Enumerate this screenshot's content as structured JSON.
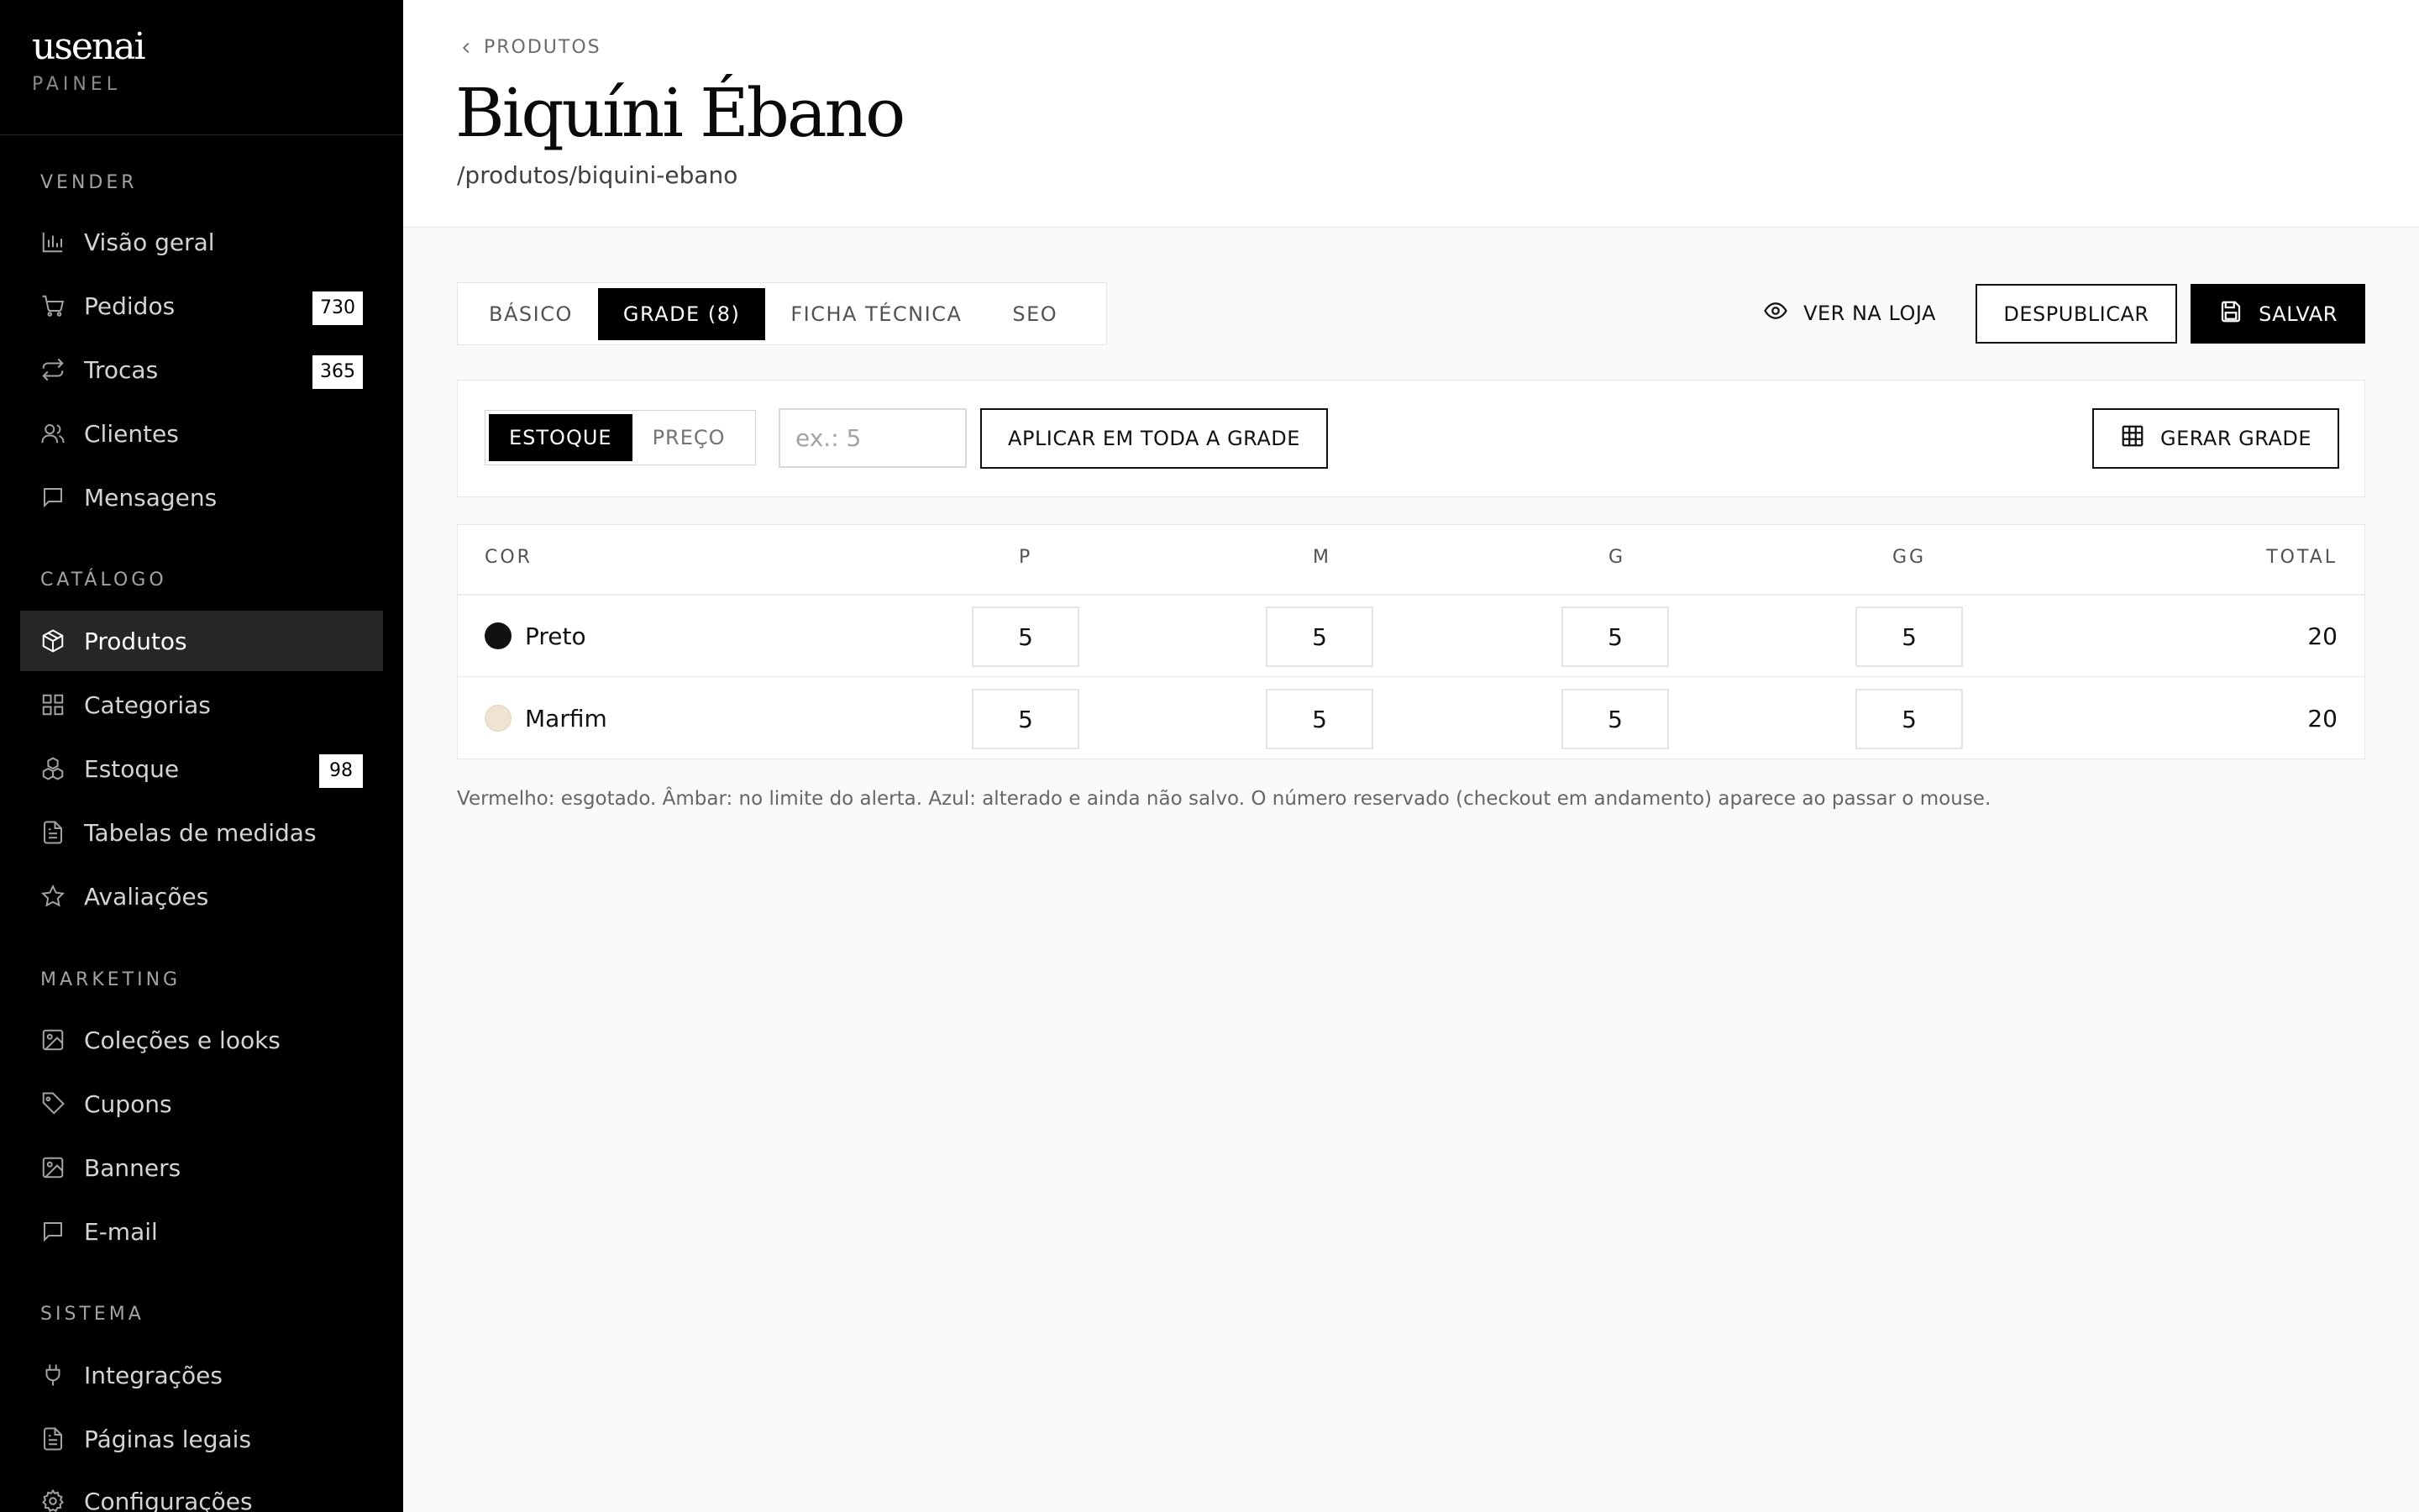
{
  "brand": {
    "logo": "usenai",
    "subtitle": "PAINEL"
  },
  "sidebar": {
    "sections": [
      {
        "heading": "VENDER",
        "items": [
          {
            "label": "Visão geral",
            "icon": "bar-chart-icon"
          },
          {
            "label": "Pedidos",
            "icon": "cart-icon",
            "badge": "730"
          },
          {
            "label": "Trocas",
            "icon": "repeat-icon",
            "badge": "365"
          },
          {
            "label": "Clientes",
            "icon": "users-icon"
          },
          {
            "label": "Mensagens",
            "icon": "message-icon"
          }
        ]
      },
      {
        "heading": "CATÁLOGO",
        "items": [
          {
            "label": "Produtos",
            "icon": "box-icon",
            "active": true
          },
          {
            "label": "Categorias",
            "icon": "grid-icon"
          },
          {
            "label": "Estoque",
            "icon": "boxes-icon",
            "badge": "98"
          },
          {
            "label": "Tabelas de medidas",
            "icon": "document-icon"
          },
          {
            "label": "Avaliações",
            "icon": "star-icon"
          }
        ]
      },
      {
        "heading": "MARKETING",
        "items": [
          {
            "label": "Coleções e looks",
            "icon": "image-icon"
          },
          {
            "label": "Cupons",
            "icon": "tag-icon"
          },
          {
            "label": "Banners",
            "icon": "image-icon"
          },
          {
            "label": "E-mail",
            "icon": "message-icon"
          }
        ]
      },
      {
        "heading": "SISTEMA",
        "items": [
          {
            "label": "Integrações",
            "icon": "plug-icon"
          },
          {
            "label": "Páginas legais",
            "icon": "document-icon"
          },
          {
            "label": "Configurações",
            "icon": "gear-icon"
          }
        ]
      }
    ]
  },
  "header": {
    "breadcrumb": "PRODUTOS",
    "title": "Biquíni Ébano",
    "slug": "/produtos/biquini-ebano"
  },
  "tabs": [
    {
      "label": "BÁSICO"
    },
    {
      "label": "GRADE (8)",
      "active": true
    },
    {
      "label": "FICHA TÉCNICA"
    },
    {
      "label": "SEO"
    }
  ],
  "actions": {
    "view_store": "VER NA LOJA",
    "unpublish": "DESPUBLICAR",
    "save": "SALVAR"
  },
  "bulk": {
    "mode_options": [
      "ESTOQUE",
      "PREÇO"
    ],
    "active_mode": "ESTOQUE",
    "input_placeholder": "ex.: 5",
    "input_value": "",
    "apply_label": "APLICAR EM TODA A GRADE",
    "generate_label": "GERAR GRADE"
  },
  "grid": {
    "headers": {
      "color": "COR",
      "sizes": [
        "P",
        "M",
        "G",
        "GG"
      ],
      "total": "TOTAL"
    },
    "rows": [
      {
        "color": "Preto",
        "swatch": "#111111",
        "values": [
          "5",
          "5",
          "5",
          "5"
        ],
        "total": "20"
      },
      {
        "color": "Marfim",
        "swatch": "#efe3d1",
        "values": [
          "5",
          "5",
          "5",
          "5"
        ],
        "total": "20"
      }
    ]
  },
  "help_text": "Vermelho: esgotado. Âmbar: no limite do alerta. Azul: alterado e ainda não salvo. O número reservado (checkout em andamento) aparece ao passar o mouse."
}
